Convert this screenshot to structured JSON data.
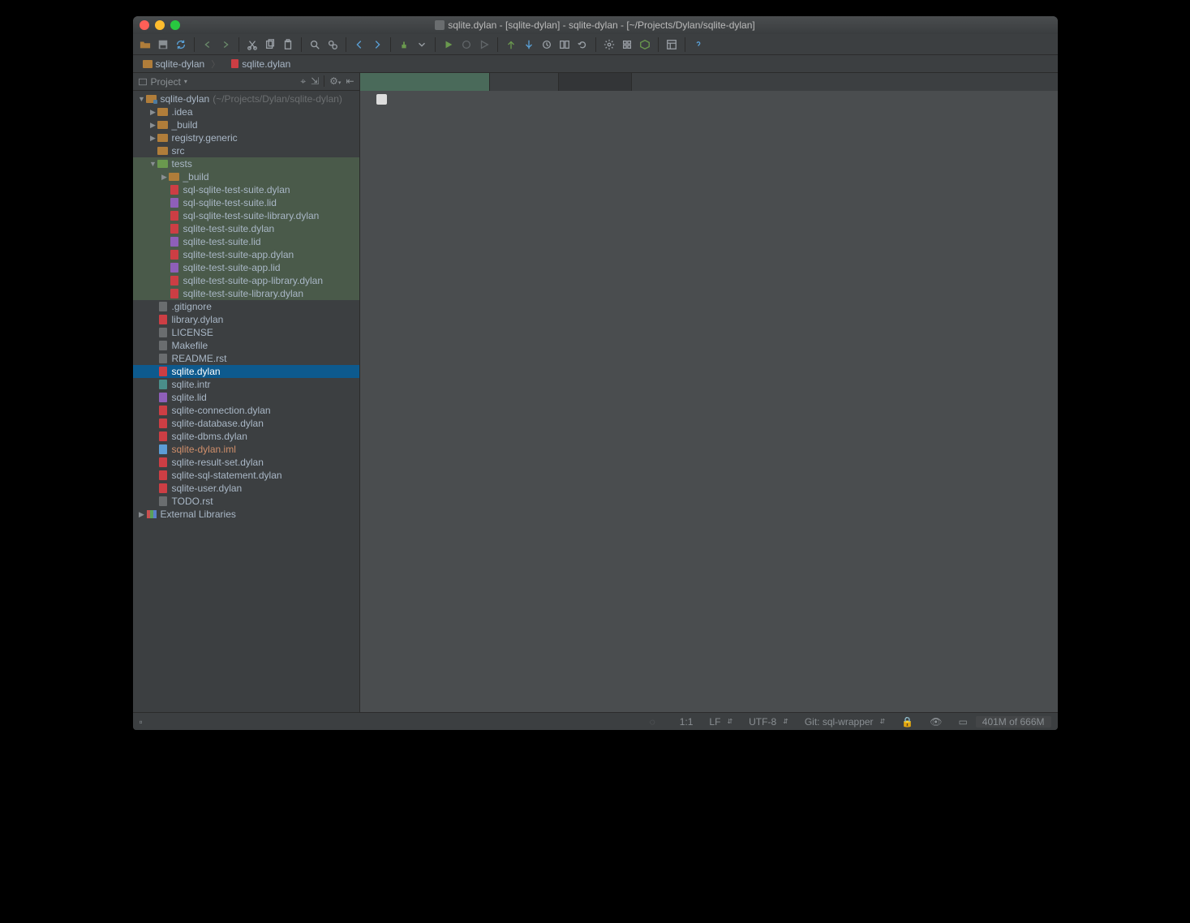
{
  "window_title": "sqlite.dylan - [sqlite-dylan] - sqlite-dylan - [~/Projects/Dylan/sqlite-dylan]",
  "breadcrumb": [
    {
      "icon": "folder",
      "label": "sqlite-dylan"
    },
    {
      "icon": "dylan",
      "label": "sqlite.dylan"
    }
  ],
  "sidebar": {
    "header": "Project",
    "tree": [
      {
        "d": 0,
        "exp": "open",
        "icon": "proj",
        "label": "sqlite-dylan",
        "dim": "(~/Projects/Dylan/sqlite-dylan)"
      },
      {
        "d": 1,
        "exp": "closed",
        "icon": "folder",
        "label": ".idea"
      },
      {
        "d": 1,
        "exp": "closed",
        "icon": "folder",
        "label": "_build"
      },
      {
        "d": 1,
        "exp": "closed",
        "icon": "folder",
        "label": "registry.generic"
      },
      {
        "d": 1,
        "exp": "none",
        "icon": "folder",
        "label": "src"
      },
      {
        "d": 1,
        "exp": "open",
        "icon": "gfolder",
        "label": "tests",
        "hl": true
      },
      {
        "d": 2,
        "exp": "closed",
        "icon": "folder",
        "label": "_build",
        "hl": true
      },
      {
        "d": 2,
        "exp": "none",
        "icon": "dylan",
        "label": "sql-sqlite-test-suite.dylan",
        "hl": true
      },
      {
        "d": 2,
        "exp": "none",
        "icon": "lid",
        "label": "sql-sqlite-test-suite.lid",
        "hl": true
      },
      {
        "d": 2,
        "exp": "none",
        "icon": "dylan",
        "label": "sql-sqlite-test-suite-library.dylan",
        "hl": true
      },
      {
        "d": 2,
        "exp": "none",
        "icon": "dylan",
        "label": "sqlite-test-suite.dylan",
        "hl": true
      },
      {
        "d": 2,
        "exp": "none",
        "icon": "lid",
        "label": "sqlite-test-suite.lid",
        "hl": true
      },
      {
        "d": 2,
        "exp": "none",
        "icon": "dylan",
        "label": "sqlite-test-suite-app.dylan",
        "hl": true
      },
      {
        "d": 2,
        "exp": "none",
        "icon": "lid",
        "label": "sqlite-test-suite-app.lid",
        "hl": true
      },
      {
        "d": 2,
        "exp": "none",
        "icon": "dylan",
        "label": "sqlite-test-suite-app-library.dylan",
        "hl": true
      },
      {
        "d": 2,
        "exp": "none",
        "icon": "dylan",
        "label": "sqlite-test-suite-library.dylan",
        "hl": true
      },
      {
        "d": 1,
        "exp": "none",
        "icon": "file",
        "label": ".gitignore"
      },
      {
        "d": 1,
        "exp": "none",
        "icon": "dylan",
        "label": "library.dylan"
      },
      {
        "d": 1,
        "exp": "none",
        "icon": "file",
        "label": "LICENSE"
      },
      {
        "d": 1,
        "exp": "none",
        "icon": "file",
        "label": "Makefile"
      },
      {
        "d": 1,
        "exp": "none",
        "icon": "file",
        "label": "README.rst"
      },
      {
        "d": 1,
        "exp": "none",
        "icon": "dylan",
        "label": "sqlite.dylan",
        "sel": true
      },
      {
        "d": 1,
        "exp": "none",
        "icon": "misc",
        "label": "sqlite.intr"
      },
      {
        "d": 1,
        "exp": "none",
        "icon": "lid",
        "label": "sqlite.lid"
      },
      {
        "d": 1,
        "exp": "none",
        "icon": "dylan",
        "label": "sqlite-connection.dylan"
      },
      {
        "d": 1,
        "exp": "none",
        "icon": "dylan",
        "label": "sqlite-database.dylan"
      },
      {
        "d": 1,
        "exp": "none",
        "icon": "dylan",
        "label": "sqlite-dbms.dylan"
      },
      {
        "d": 1,
        "exp": "none",
        "icon": "iml",
        "label": "sqlite-dylan.iml",
        "iml": true
      },
      {
        "d": 1,
        "exp": "none",
        "icon": "dylan",
        "label": "sqlite-result-set.dylan"
      },
      {
        "d": 1,
        "exp": "none",
        "icon": "dylan",
        "label": "sqlite-sql-statement.dylan"
      },
      {
        "d": 1,
        "exp": "none",
        "icon": "dylan",
        "label": "sqlite-user.dylan"
      },
      {
        "d": 1,
        "exp": "none",
        "icon": "file",
        "label": "TODO.rst"
      },
      {
        "d": 0,
        "exp": "closed",
        "icon": "lib",
        "label": "External Libraries"
      }
    ]
  },
  "status": {
    "cursor": "1:1",
    "line_sep": "LF",
    "encoding": "UTF-8",
    "git": "Git: sql-wrapper",
    "memory": "401M of 666M"
  }
}
